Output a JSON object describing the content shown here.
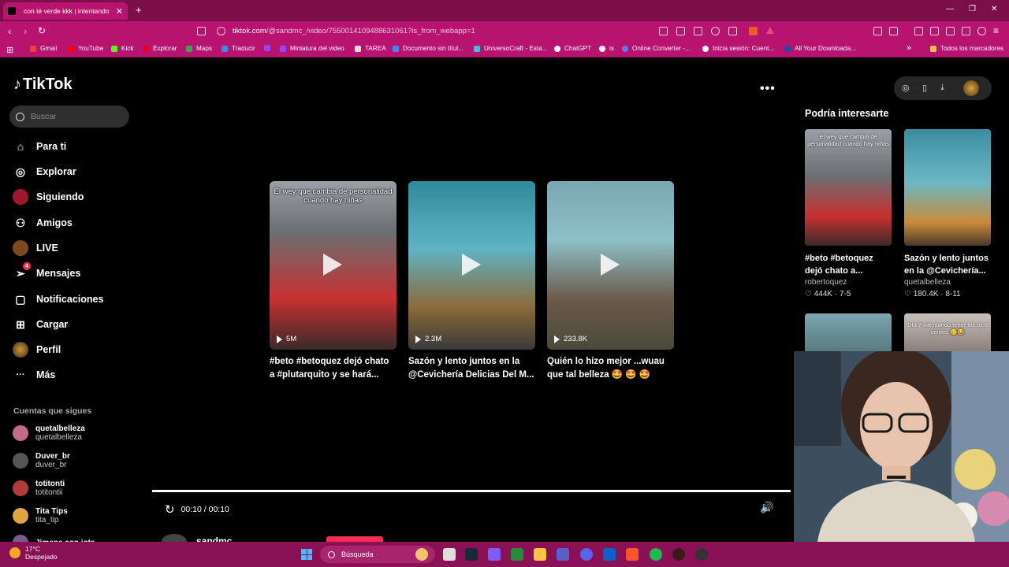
{
  "browser": {
    "tab_title": "con té verde kkk | intentando",
    "tab_close": "✕",
    "new_tab": "+",
    "url_host": "tiktok.com",
    "url_path": "/@sandmc_/video/7550014109488631061?is_from_webapp=1",
    "win_min": "—",
    "win_max": "❐",
    "win_close": "✕",
    "bookmarks": [
      "Gmail",
      "YouTube",
      "Kick",
      "Explorar",
      "Maps",
      "Traducir",
      "Miniatura del video",
      "TAREA",
      "Documento sin títul...",
      "UniversoCraft - Esta...",
      "ChatGPT",
      "is",
      "Online Converter -...",
      "Inicia sesión: Cuent...",
      "All Your Downloada..."
    ],
    "bookmarks_more": "»",
    "all_bookmarks": "Todos los marcadores"
  },
  "sidebar": {
    "logo": "TikTok",
    "search_placeholder": "Buscar",
    "nav": [
      {
        "label": "Para ti",
        "icon": "⌂"
      },
      {
        "label": "Explorar",
        "icon": "◎"
      },
      {
        "label": "Siguiendo",
        "icon": ""
      },
      {
        "label": "Amigos",
        "icon": "⚇"
      },
      {
        "label": "LIVE",
        "icon": ""
      },
      {
        "label": "Mensajes",
        "icon": "➢",
        "badge": "4"
      },
      {
        "label": "Notificaciones",
        "icon": "▢"
      },
      {
        "label": "Cargar",
        "icon": "⊞"
      },
      {
        "label": "Perfil",
        "icon": ""
      },
      {
        "label": "Más",
        "icon": "···"
      }
    ],
    "following_header": "Cuentas que sigues",
    "following": [
      {
        "name": "quetalbelleza",
        "handle": "quetalbelleza"
      },
      {
        "name": "Duver_br",
        "handle": "duver_br"
      },
      {
        "name": "totitonti",
        "handle": "totitontii"
      },
      {
        "name": "Tita Tips",
        "handle": "tita_tip"
      },
      {
        "name": "Jimena con jota",
        "handle": ""
      }
    ]
  },
  "main": {
    "more": "•••",
    "cards": [
      {
        "views": "5M",
        "title": "#beto #betoquez dejó chato a #plutarquito y se hará...",
        "caption": "El wey que cambia de personalidad cuando hay niñas"
      },
      {
        "views": "2.3M",
        "title": "Sazón y lento juntos en la @Cevichería Delicias Del M...",
        "caption": ""
      },
      {
        "views": "233.8K",
        "title": "Quién lo hizo mejor ...wuau que tal belleza 🤩 🤩 🤩",
        "caption": ""
      }
    ],
    "time": "00:10 / 00:10",
    "replay_icon": "↻",
    "volume_icon": "🔊",
    "author": "sandmc"
  },
  "suggested": {
    "title": "Podría interesarte",
    "items": [
      {
        "title": "#beto #betoquez dejó chato a...",
        "author": "robertoquez",
        "stats": "♡ 444K · 7-5",
        "caption": "El wey que cambia de personalidad cuando hay niñas"
      },
      {
        "title": "Sazón y lento juntos en la @Cevichería...",
        "author": "quetalbelleza",
        "stats": "♡ 180.4K · 8-11",
        "caption": ""
      }
    ],
    "next_caption": "Día 7 intentando tener los ojos verdes 🥲😂"
  },
  "taskbar": {
    "temp": "17°C",
    "weather": "Despejado",
    "search": "Búsqueda"
  },
  "colors": {
    "brand": "#fe2c55",
    "chrome": "#b8136f",
    "taskbar": "#8a1055"
  }
}
